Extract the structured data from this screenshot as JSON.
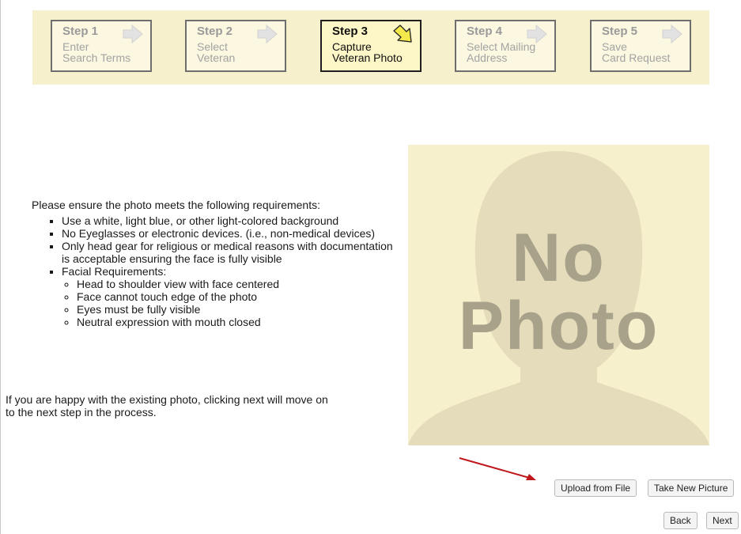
{
  "steps": [
    {
      "title": "Step 1",
      "line1": "Enter",
      "line2": "Search Terms",
      "active": false
    },
    {
      "title": "Step 2",
      "line1": "Select",
      "line2": "Veteran",
      "active": false
    },
    {
      "title": "Step 3",
      "line1": "Capture",
      "line2": "Veteran Photo",
      "active": true
    },
    {
      "title": "Step 4",
      "line1": "Select Mailing",
      "line2": "Address",
      "active": false
    },
    {
      "title": "Step 5",
      "line1": "Save",
      "line2": "Card Request",
      "active": false
    }
  ],
  "photo": {
    "line1": "No",
    "line2": "Photo"
  },
  "requirements": {
    "intro": "Please ensure the photo meets the following requirements:",
    "items": [
      "Use a white, light blue, or other light-colored background",
      "No Eyeglasses or electronic devices. (i.e., non-medical devices)",
      "Only head gear for religious or medical reasons with documentation is acceptable ensuring the face is fully visible",
      "Facial Requirements:"
    ],
    "facial": [
      "Head to shoulder view with face centered",
      "Face cannot touch edge of the photo",
      "Eyes must be fully visible",
      "Neutral expression with mouth closed"
    ]
  },
  "happy_text": "If you are happy with the existing photo, clicking next will move on to the next step in the process.",
  "buttons": {
    "upload": "Upload from File",
    "take_new": "Take New Picture",
    "back": "Back",
    "next": "Next"
  },
  "colors": {
    "panel": "#f6f0cc",
    "active_arrow": "#f5e84a",
    "annotation_arrow": "#c0171d"
  }
}
